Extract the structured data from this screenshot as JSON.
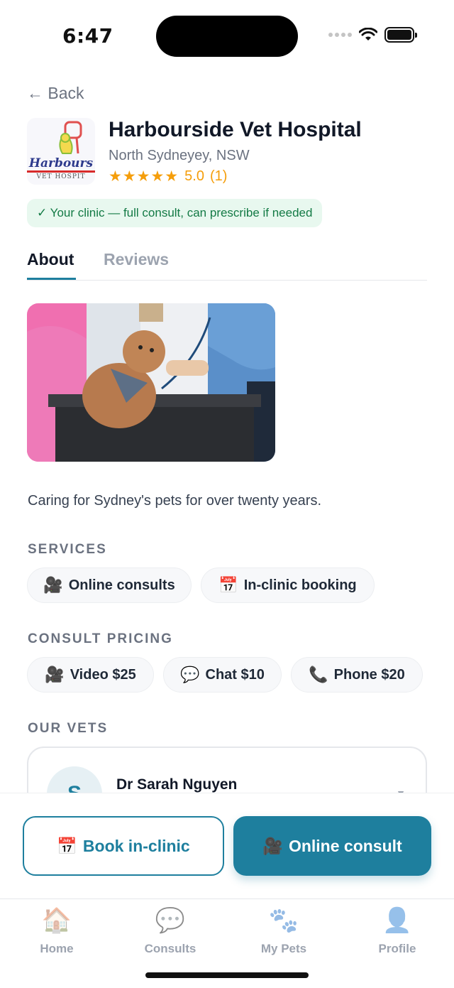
{
  "status_bar": {
    "time": "6:47"
  },
  "nav": {
    "back_label": "← Back"
  },
  "clinic": {
    "logo_word": "Harbours",
    "logo_sub": "VET HOSPIT",
    "name": "Harbourside Vet Hospital",
    "location": "North Sydneyey, NSW",
    "stars": "★★★★★",
    "rating": "5.0",
    "review_count": "(1)",
    "eligibility": "✓ Your clinic — full consult, can prescribe if needed"
  },
  "tabs": [
    {
      "label": "About",
      "active": true
    },
    {
      "label": "Reviews",
      "active": false
    }
  ],
  "about": {
    "description": "Caring for Sydney's pets for over twenty years."
  },
  "services": {
    "heading": "SERVICES",
    "items": [
      {
        "icon": "video-camera-icon",
        "glyph": "🎥",
        "label": "Online consults"
      },
      {
        "icon": "calendar-icon",
        "glyph": "📅",
        "label": "In-clinic booking"
      }
    ]
  },
  "pricing": {
    "heading": "CONSULT PRICING",
    "items": [
      {
        "icon": "video-camera-icon",
        "glyph": "🎥",
        "label": "Video $25"
      },
      {
        "icon": "chat-bubble-icon",
        "glyph": "💬",
        "label": "Chat $10"
      },
      {
        "icon": "phone-icon",
        "glyph": "📞",
        "label": "Phone $20"
      }
    ]
  },
  "vets": {
    "heading": "OUR VETS",
    "items": [
      {
        "initial": "S",
        "name": "Dr Sarah Nguyen"
      }
    ]
  },
  "actions": {
    "book_icon": "📅",
    "book_label": "Book in-clinic",
    "online_icon": "🎥",
    "online_label": "Online consult"
  },
  "tab_bar": [
    {
      "icon": "home-icon",
      "glyph": "🏠",
      "label": "Home"
    },
    {
      "icon": "chat-bubble-icon",
      "glyph": "💬",
      "label": "Consults"
    },
    {
      "icon": "paw-icon",
      "glyph": "🐾",
      "label": "My Pets"
    },
    {
      "icon": "profile-icon",
      "glyph": "👤",
      "label": "Profile"
    }
  ],
  "colors": {
    "accent": "#1e7f9e",
    "star": "#f59e0b",
    "success_text": "#137a45",
    "success_bg": "#e8f8ef"
  }
}
